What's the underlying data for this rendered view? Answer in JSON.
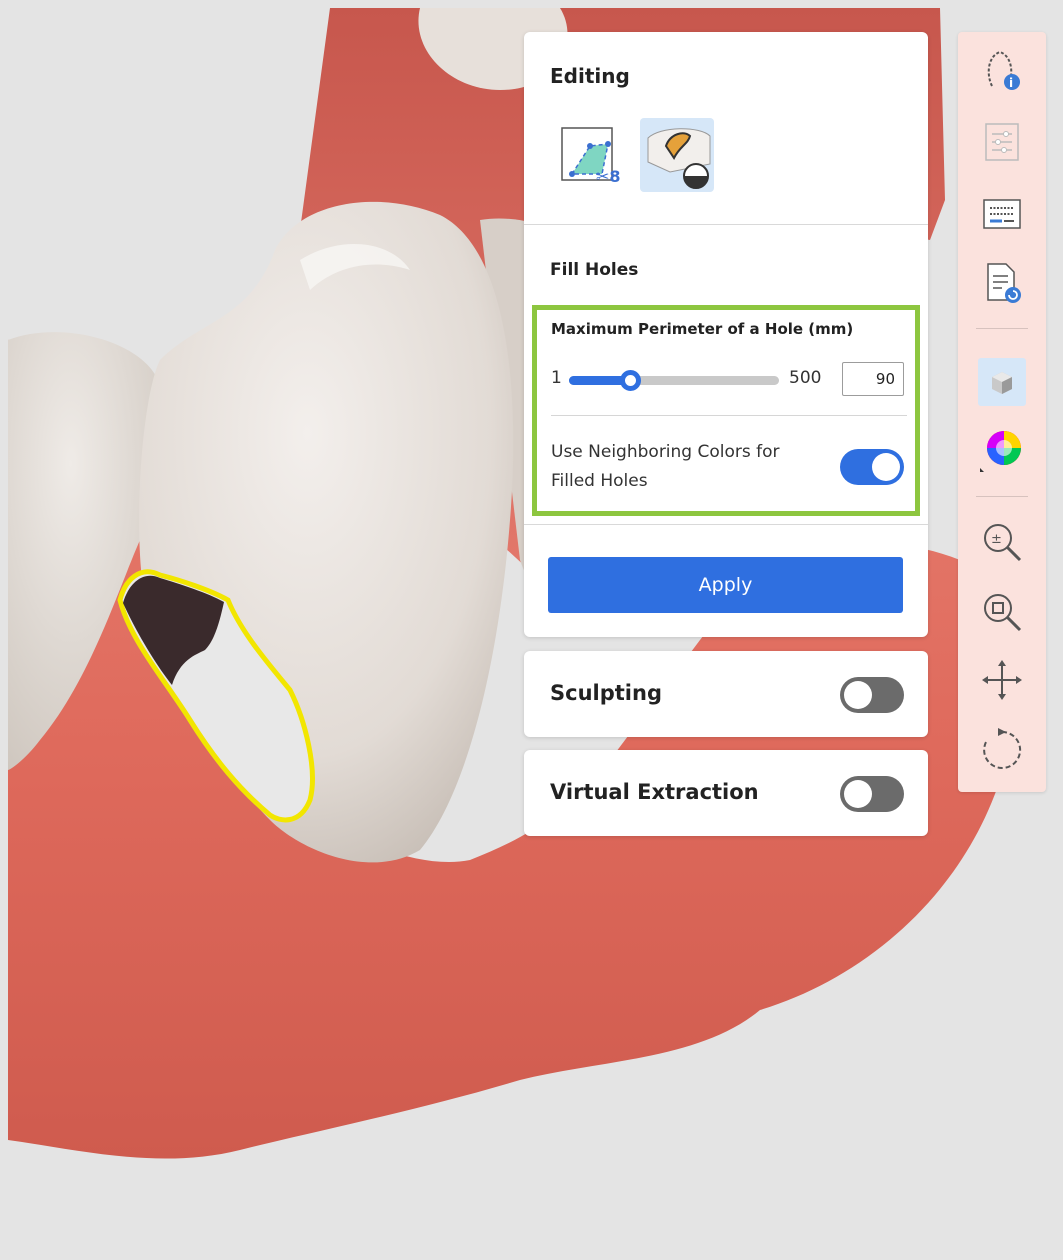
{
  "editing": {
    "title": "Editing",
    "tools": [
      "trim-tool-icon",
      "fill-holes-tool-icon"
    ]
  },
  "fill_holes": {
    "title": "Fill Holes",
    "perimeter_label": "Maximum Perimeter of a Hole (mm)",
    "slider": {
      "min_label": "1",
      "max_label": "500",
      "min": 1,
      "max": 500,
      "value": 90
    },
    "input_value": "90",
    "neighbor_label": "Use Neighboring Colors for Filled Holes",
    "neighbor_toggle_on": true,
    "apply_label": "Apply"
  },
  "sculpting": {
    "label": "Sculpting",
    "toggle_on": false
  },
  "virtual_extraction": {
    "label": "Virtual Extraction",
    "toggle_on": false
  },
  "toolbar": {
    "icons": [
      "dental-arch-info-icon",
      "adjustments-icon",
      "keyboard-icon",
      "report-icon",
      "texture-cube-icon",
      "color-wheel-icon",
      "zoom-fit-icon",
      "zoom-area-icon",
      "pan-icon",
      "rotate-icon"
    ]
  },
  "colors": {
    "accent": "#2f6fe0",
    "highlight_border": "#8dc63f",
    "gum": "#e26b5e",
    "tooth": "#ebe6e1",
    "hole_outline": "#f2e600"
  }
}
